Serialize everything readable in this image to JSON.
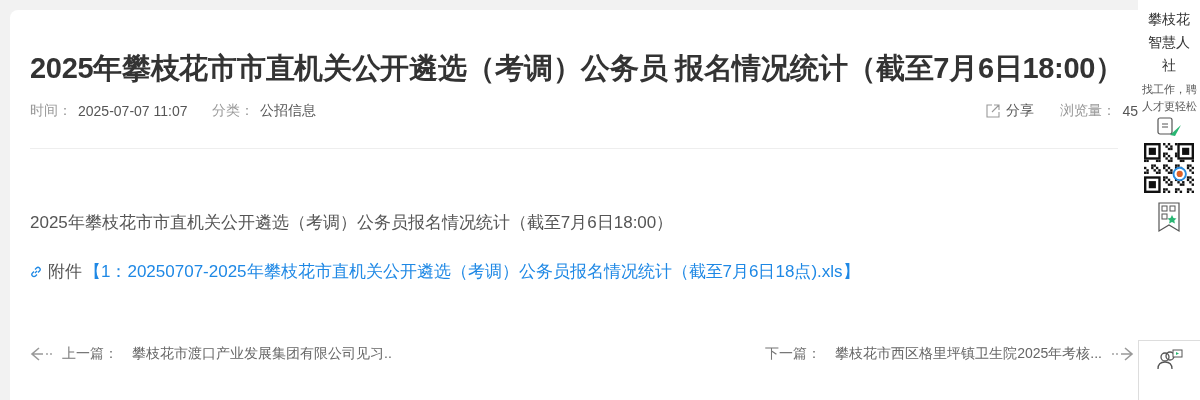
{
  "article": {
    "title": "2025年攀枝花市市直机关公开遴选（考调）公务员 报名情况统计（截至7月6日18:00）",
    "meta": [
      {
        "label": "时间：",
        "value": "2025-07-07 11:07"
      },
      {
        "label": "分类：",
        "value": "公招信息"
      }
    ],
    "share": "分享",
    "views": {
      "label": "浏览量：",
      "value": "45"
    },
    "body": "2025年攀枝花市市直机关公开遴选（考调）公务员报名情况统计（截至7月6日18:00）",
    "attachment": {
      "label": "附件",
      "link": "【1：20250707-2025年攀枝花市直机关公开遴选（考调）公务员报名情况统计（截至7月6日18点).xls】"
    },
    "prev": {
      "label": "上一篇：",
      "title": "攀枝花市渡口产业发展集团有限公司见习.."
    },
    "next": {
      "label": "下一篇：",
      "title": "攀枝花市西区格里坪镇卫生院2025年考核..."
    }
  },
  "sidebar": {
    "title": "攀枝花智慧人社",
    "slogan": "找工作，聘人才更轻松"
  }
}
